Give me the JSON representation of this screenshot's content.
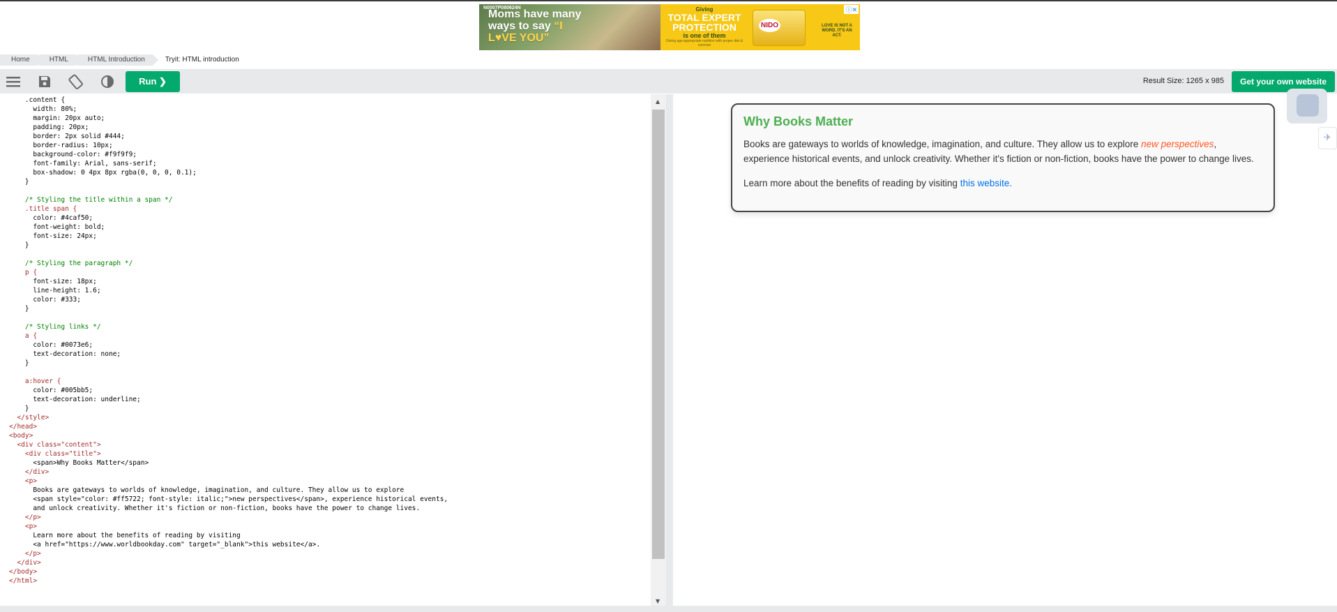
{
  "ad": {
    "headline_1": "Moms have many ways to say",
    "headline_love": "“I L♥VE YOU”",
    "code": "N0007P080624N",
    "giving": "Giving",
    "protection": "TOTAL EXPERT PROTECTION",
    "one_of_them": "is one of them",
    "fine_print": "Giving age-appropriate nutrition with proper diet & exercise",
    "brand": "NIDO",
    "slogan": "LOVE IS NOT A WORD. IT'S AN ACT.",
    "close_label": "ⓘ✕"
  },
  "breadcrumb": [
    "Home",
    "HTML",
    "HTML Introduction",
    "Tryit: HTML introduction"
  ],
  "toolbar": {
    "run_label": "Run ❯",
    "result_size": "Result Size: 1265 x 985",
    "get_website_label": "Get your own website"
  },
  "result": {
    "title": "Why Books Matter",
    "p1_before": "Books are gateways to worlds of knowledge, imagination, and culture. They allow us to explore ",
    "p1_span": "new perspectives",
    "p1_after": ", experience historical events, and unlock creativity. Whether it's fiction or non-fiction, books have the power to change lives.",
    "p2_before": "Learn more about the benefits of reading by visiting ",
    "p2_link": "this website."
  },
  "code_lines": [
    "    .content {",
    "      width: 80%;",
    "      margin: 20px auto;",
    "      padding: 20px;",
    "      border: 2px solid #444;",
    "      border-radius: 10px;",
    "      background-color: #f9f9f9;",
    "      font-family: Arial, sans-serif;",
    "      box-shadow: 0 4px 8px rgba(0, 0, 0, 0.1);",
    "    }",
    "",
    "    /* Styling the title within a span */",
    "    .title span {",
    "      color: #4caf50;",
    "      font-weight: bold;",
    "      font-size: 24px;",
    "    }",
    "",
    "    /* Styling the paragraph */",
    "    p {",
    "      font-size: 18px;",
    "      line-height: 1.6;",
    "      color: #333;",
    "    }",
    "",
    "    /* Styling links */",
    "    a {",
    "      color: #0073e6;",
    "      text-decoration: none;",
    "    }",
    "",
    "    a:hover {",
    "      color: #005bb5;",
    "      text-decoration: underline;",
    "    }",
    "  </style>",
    "</head>",
    "<body>",
    "  <div class=\"content\">",
    "    <div class=\"title\">",
    "      <span>Why Books Matter</span>",
    "    </div>",
    "    <p>",
    "      Books are gateways to worlds of knowledge, imagination, and culture. They allow us to explore",
    "      <span style=\"color: #ff5722; font-style: italic;\">new perspectives</span>, experience historical events,",
    "      and unlock creativity. Whether it's fiction or non-fiction, books have the power to change lives.",
    "    </p>",
    "    <p>",
    "      Learn more about the benefits of reading by visiting",
    "      <a href=\"https://www.worldbookday.com\" target=\"_blank\">this website</a>.",
    "    </p>",
    "  </div>",
    "</body>",
    "</html>"
  ],
  "colors": {
    "accent_green": "#04aa6d",
    "title_green": "#4caf50",
    "link_blue": "#0073e6",
    "span_orange": "#ff5722"
  }
}
